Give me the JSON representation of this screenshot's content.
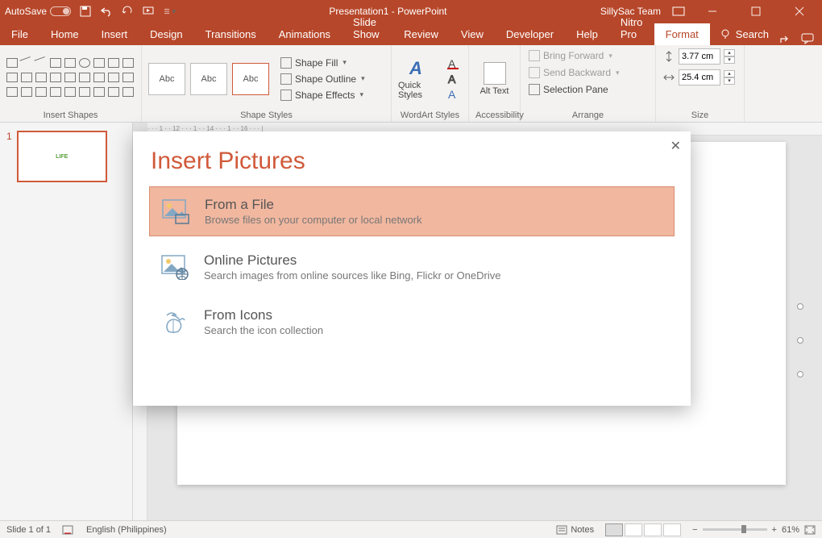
{
  "titlebar": {
    "autosave_label": "AutoSave",
    "doc_title": "Presentation1 - PowerPoint",
    "user": "SillySac Team"
  },
  "menu": {
    "tabs": [
      "File",
      "Home",
      "Insert",
      "Design",
      "Transitions",
      "Animations",
      "Slide Show",
      "Review",
      "View",
      "Developer",
      "Help",
      "Nitro Pro"
    ],
    "active_tab": "Format",
    "search_label": "Search"
  },
  "ribbon": {
    "groups": {
      "shapes": "Insert Shapes",
      "styles": "Shape Styles",
      "wordart": "WordArt Styles",
      "access": "Accessibility",
      "arrange": "Arrange",
      "size": "Size"
    },
    "style_sample": "Abc",
    "fill": "Shape Fill",
    "outline": "Shape Outline",
    "effects": "Shape Effects",
    "quick_styles": "Quick Styles",
    "alt_text": "Alt Text",
    "bring_forward": "Bring Forward",
    "send_backward": "Send Backward",
    "selection_pane": "Selection Pane",
    "height": "3.77 cm",
    "width": "25.4 cm"
  },
  "thumb": {
    "num": "1",
    "text": "LIFE"
  },
  "ruler_text": "· · · 1 · · 12 · · · 1 · · 14 · · · 1 · · 16 · · · |",
  "dialog": {
    "title": "Insert Pictures",
    "opts": [
      {
        "t1": "From a File",
        "t2": "Browse files on your computer or local network"
      },
      {
        "t1": "Online Pictures",
        "t2": "Search images from online sources like Bing, Flickr or OneDrive"
      },
      {
        "t1": "From Icons",
        "t2": "Search the icon collection"
      }
    ]
  },
  "status": {
    "slide": "Slide 1 of 1",
    "lang": "English (Philippines)",
    "notes": "Notes",
    "zoom": "61%"
  }
}
